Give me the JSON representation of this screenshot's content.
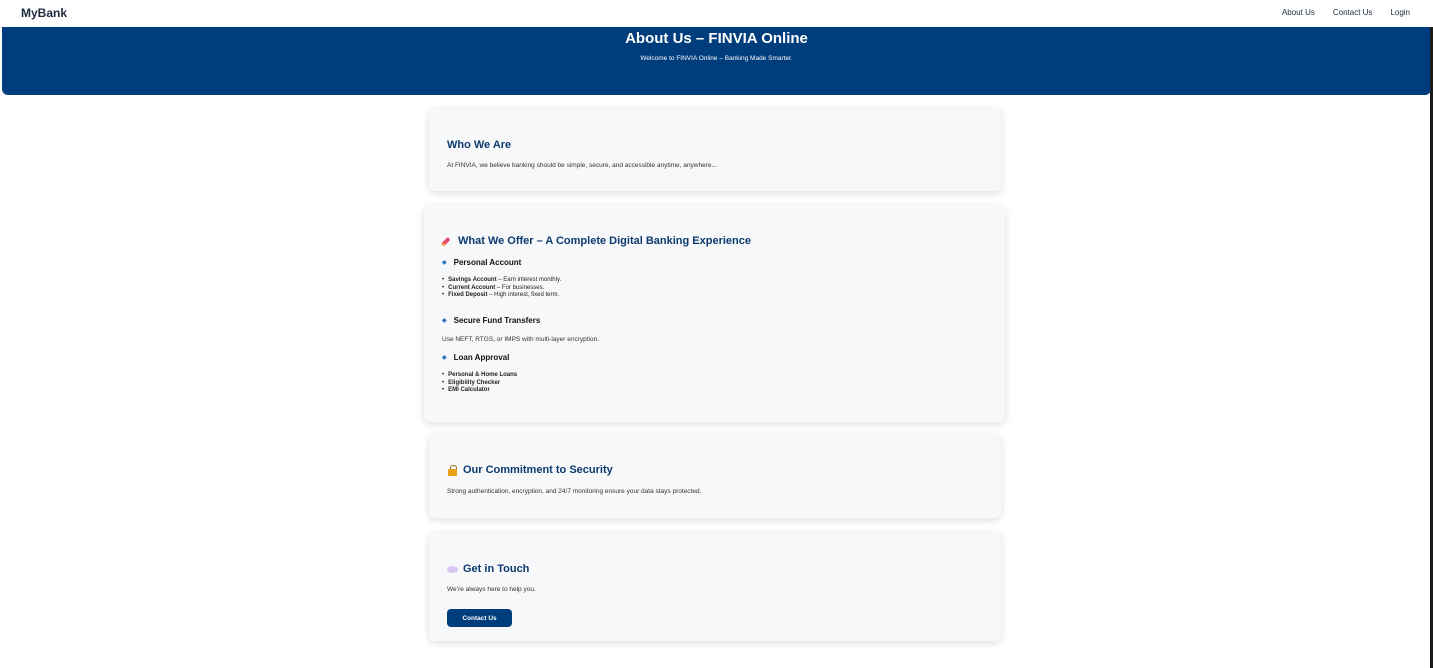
{
  "nav": {
    "brand": "MyBank",
    "links": [
      "About Us",
      "Contact Us",
      "Login"
    ]
  },
  "hero": {
    "title": "About Us – FINVIA Online",
    "subtitle": "Welcome to FINVIA Online – Banking Made Smarter."
  },
  "who": {
    "title": "Who We Are",
    "text": "At FINVIA, we believe banking should be simple, secure, and accessible anytime, anywhere..."
  },
  "offer": {
    "icon": "rocket-icon",
    "title": "What We Offer – A Complete Digital Banking Experience",
    "personal": {
      "title": "Personal Account",
      "items": [
        {
          "bold": "Savings Account",
          "rest": " – Earn interest monthly."
        },
        {
          "bold": "Current Account",
          "rest": " – For businesses."
        },
        {
          "bold": "Fixed Deposit",
          "rest": " – High interest, fixed term."
        }
      ]
    },
    "transfers": {
      "title": "Secure Fund Transfers",
      "text": "Use NEFT, RTGS, or IMPS with multi-layer encryption."
    },
    "loans": {
      "title": "Loan Approval",
      "items": [
        "Personal & Home Loans",
        "Eligibility Checker",
        "EMI Calculator"
      ]
    }
  },
  "security": {
    "icon": "lock-icon",
    "title": "Our Commitment to Security",
    "text": "Strong authentication, encryption, and 24/7 monitoring ensure your data stays protected."
  },
  "contact": {
    "icon": "speech-bubble-icon",
    "title": "Get in Touch",
    "text": "We’re always here to help you.",
    "button": "Contact Us"
  },
  "colors": {
    "primary": "#003d7d",
    "heading": "#0c3a6e",
    "card": "#f7f8fa"
  }
}
